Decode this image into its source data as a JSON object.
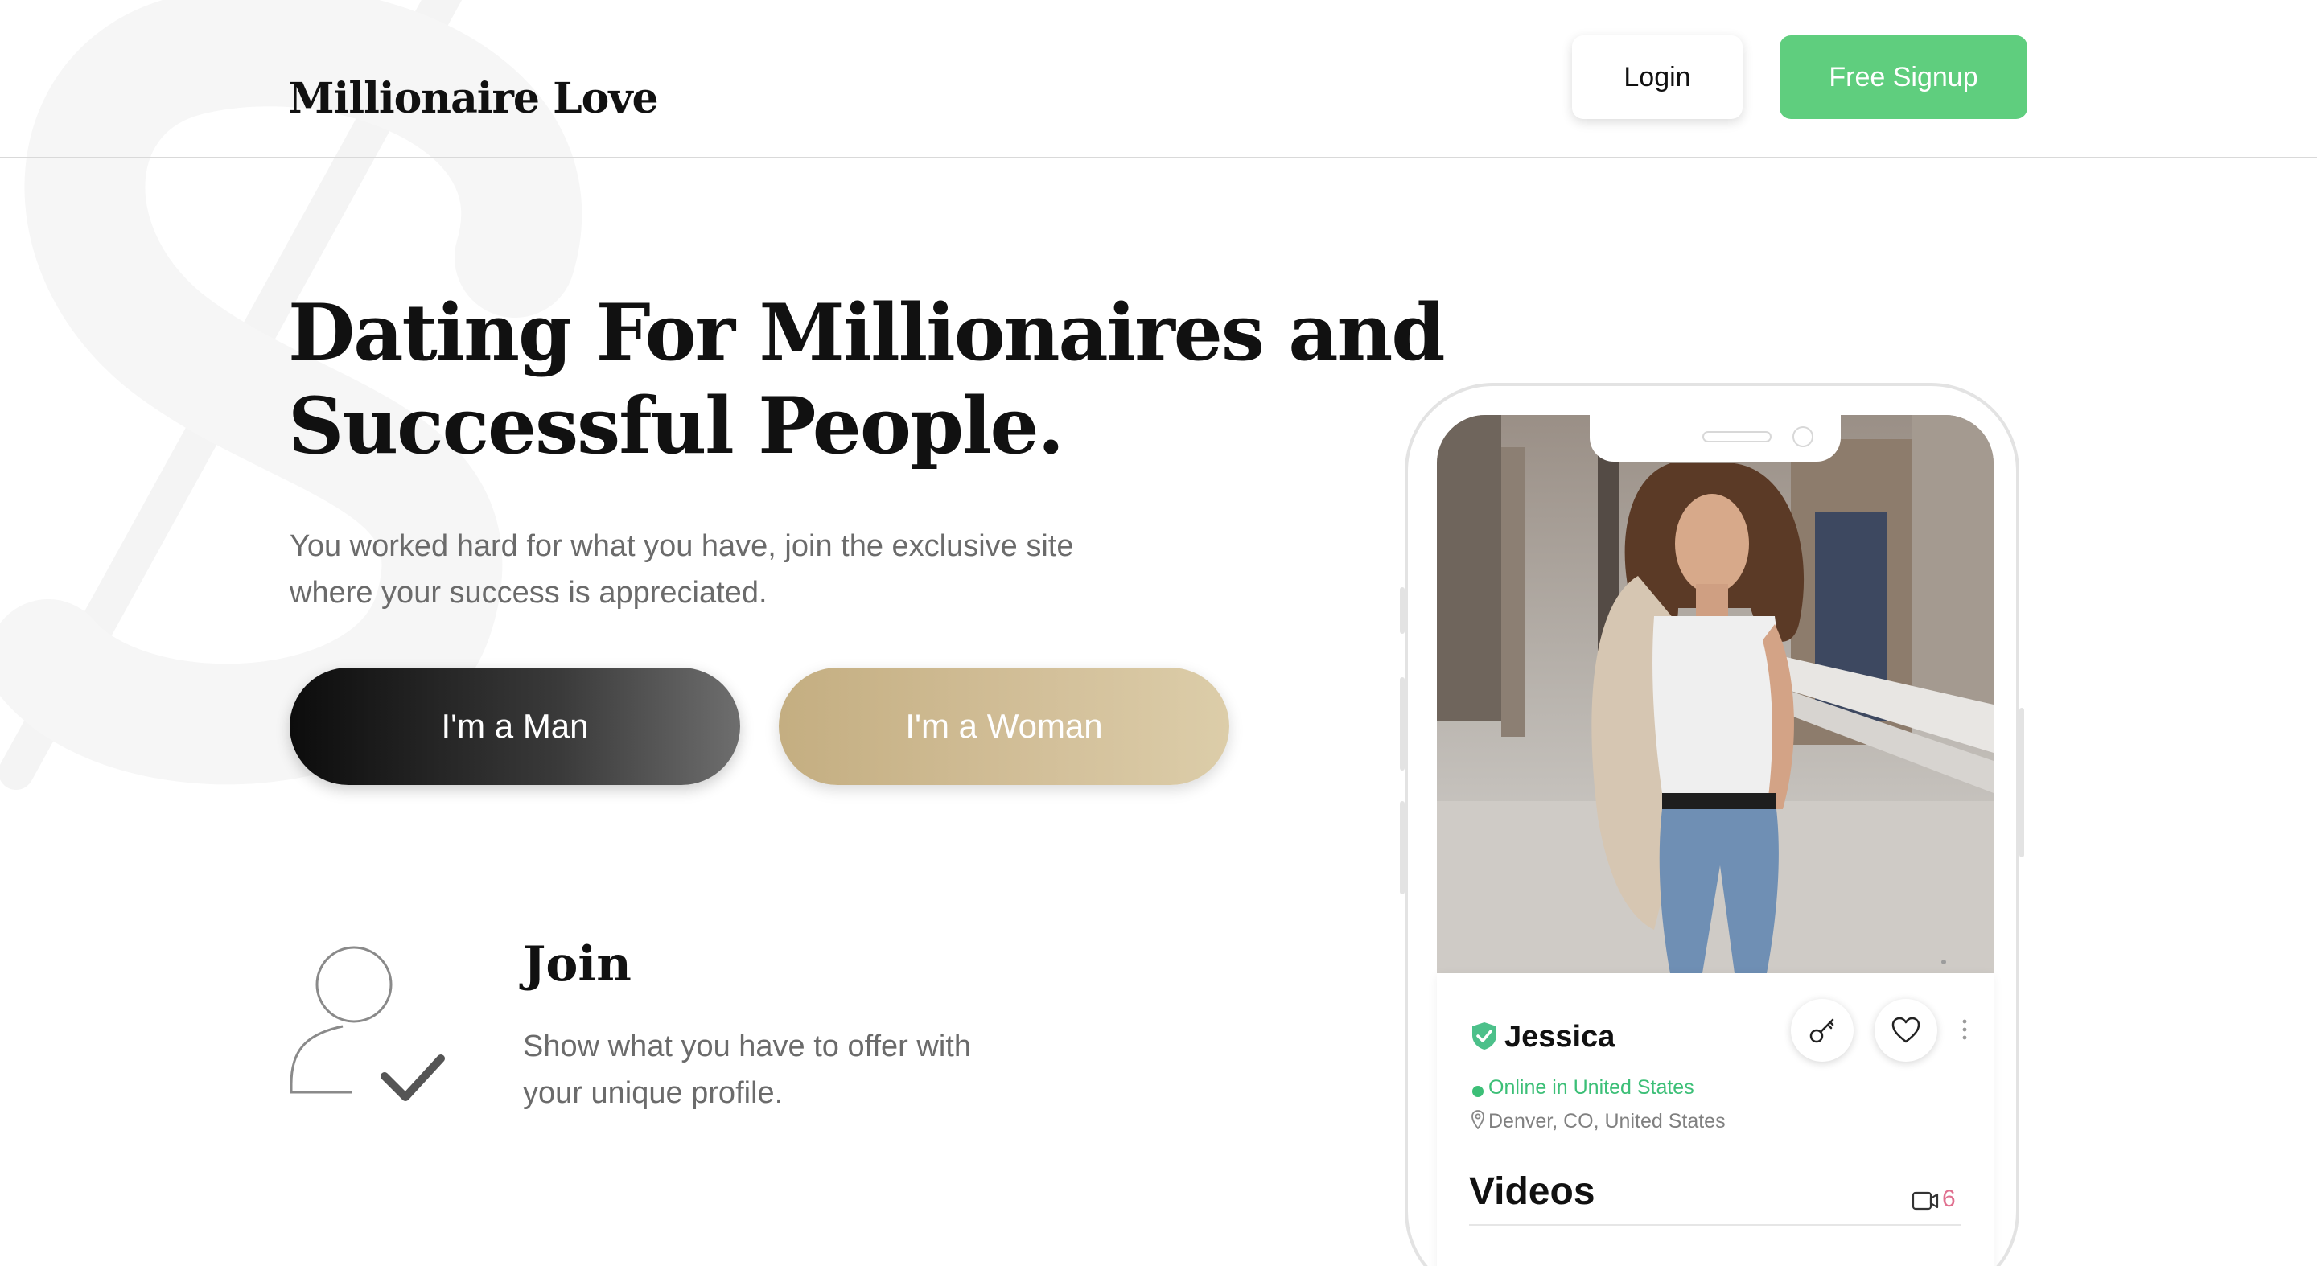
{
  "header": {
    "logo_text": "Millionaire Love",
    "login_label": "Login",
    "signup_label": "Free Signup"
  },
  "hero": {
    "title_line1": "Dating For Millionaires and",
    "title_line2": "Successful People.",
    "subtitle_line1": "You worked hard for what you have, join the exclusive site",
    "subtitle_line2": "where your success is appreciated.",
    "man_button": "I'm a Man",
    "woman_button": "I'm a Woman"
  },
  "features": {
    "join": {
      "title": "Join",
      "desc_line1": "Show what you have to offer with",
      "desc_line2": "your unique profile.",
      "icon": "user-check-icon"
    }
  },
  "phone": {
    "profile": {
      "name": "Jessica",
      "status": "Online in United States",
      "location": "Denver, CO, United States",
      "verified_icon": "shield-check-icon"
    },
    "actions": [
      "key-icon",
      "heart-icon",
      "more-vertical-icon"
    ],
    "videos": {
      "title": "Videos",
      "count": "6",
      "icon": "video-camera-icon"
    }
  },
  "colors": {
    "signup_green": "#5fce7e",
    "online_green": "#3cbf77",
    "gold": "#c9b48a",
    "video_count_pink": "#e0708f"
  }
}
